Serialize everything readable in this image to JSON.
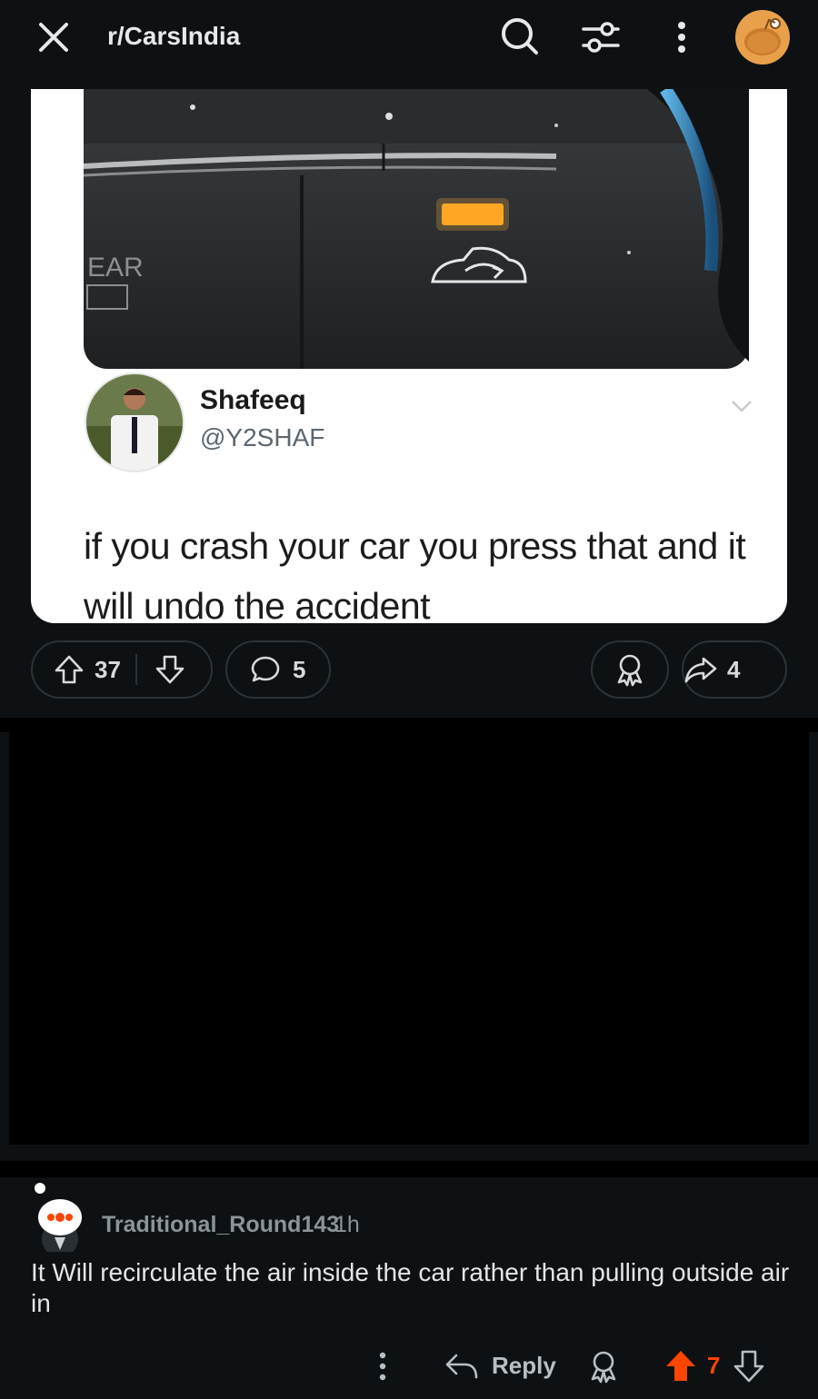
{
  "header": {
    "subreddit": "r/CarsIndia",
    "icons": [
      "close-icon",
      "search-icon",
      "filter-icon",
      "more-vertical-icon",
      "user-avatar"
    ]
  },
  "post": {
    "tweet": {
      "name": "Shafeeq",
      "handle": "@Y2SHAF",
      "text": "if you crash your car you press that and it will undo the accident",
      "dashboard_label": "EAR"
    },
    "upvotes": "37",
    "comments": "5",
    "shares": "4"
  },
  "comment": {
    "author": "Traditional_Round143",
    "time": "1h",
    "body": "It Will recirculate the air inside the car rather than pulling outside air in",
    "reply_label": "Reply",
    "score": "7",
    "upvote_color": "#ff4500"
  }
}
